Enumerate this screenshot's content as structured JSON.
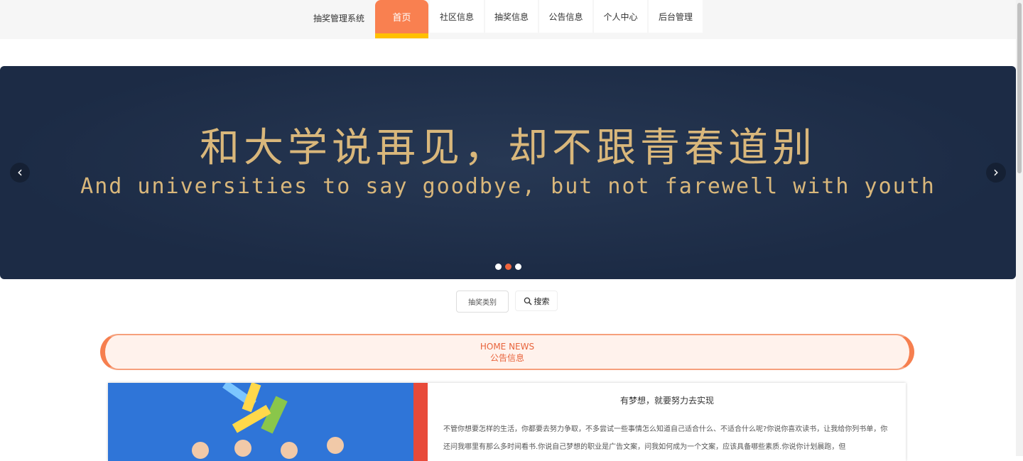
{
  "header": {
    "brand": "抽奖管理系统",
    "nav": [
      {
        "label": "首页",
        "active": true
      },
      {
        "label": "社区信息"
      },
      {
        "label": "抽奖信息"
      },
      {
        "label": "公告信息"
      },
      {
        "label": "个人中心"
      },
      {
        "label": "后台管理"
      }
    ]
  },
  "banner": {
    "title": "和大学说再见，却不跟青春道别",
    "subtitle": "And universities to say goodbye, but not farewell with youth",
    "prev_icon": "chevron-left-icon",
    "next_icon": "chevron-right-icon",
    "slide_count": 3,
    "active_slide": 2
  },
  "search": {
    "category_placeholder": "抽奖类别",
    "button_label": "搜索"
  },
  "section": {
    "title_en": "HOME NEWS",
    "title_cn": "公告信息"
  },
  "news": [
    {
      "title": "有梦想，就要努力去实现",
      "text": "不管你想要怎样的生活，你都要去努力争取，不多尝试一些事情怎么知道自己适合什么、不适合什么呢?你说你喜欢读书，让我给你列书单，你还问我哪里有那么多时间看书.你说自己梦想的职业是广告文案，问我如何成为一个文案，应该具备哪些素质.你说你计划晨跑，但"
    }
  ],
  "colors": {
    "accent": "#f98050",
    "accent_underline": "#ffc000",
    "banner_bg": "#1c2b45",
    "banner_text": "#d9b77b"
  }
}
